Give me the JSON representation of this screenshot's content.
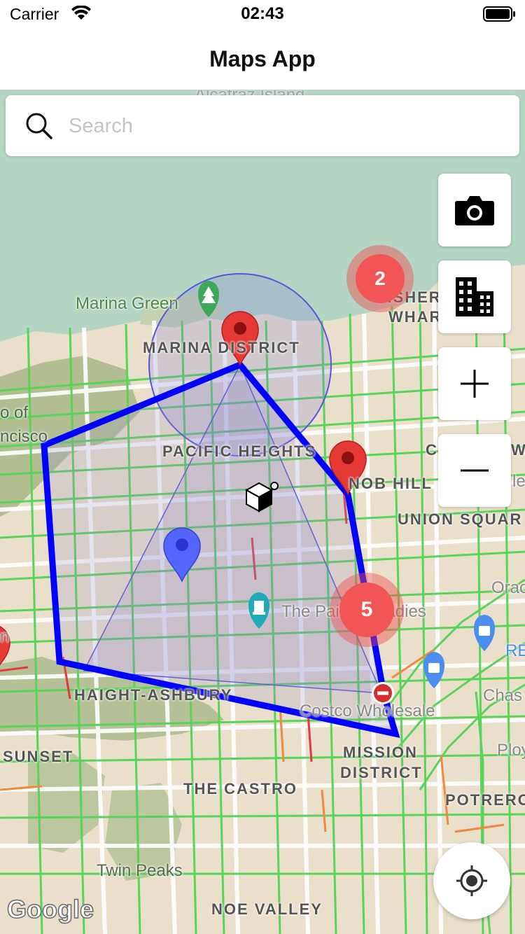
{
  "status_bar": {
    "carrier": "Carrier",
    "time": "02:43"
  },
  "nav": {
    "title": "Maps App"
  },
  "search": {
    "placeholder": "Search",
    "value": ""
  },
  "controls": {
    "camera": "camera-icon",
    "buildings": "buildings-icon",
    "zoom_in": "plus-icon",
    "zoom_out": "minus-icon",
    "my_location": "crosshair-icon"
  },
  "clusters": {
    "north": "2",
    "south": "5"
  },
  "map_labels": {
    "alcatraz": "Alcatraz Island",
    "marina_green": "Marina Green",
    "marina_district": "MARINA DISTRICT",
    "fisherman_wharf_1": "FISHERM",
    "fisherman_wharf_2": "WHAR",
    "pacific_heights": "PACIFIC HEIGHTS",
    "nob_hill": "NOB HILL",
    "union_square": "UNION SQUAR",
    "the_painted_ladies": "The Painted Ladies",
    "haight_ashbury": "HAIGHT-ASHBURY",
    "costco": "Costco Wholesale",
    "mission_district_1": "MISSION",
    "mission_district_2": "DISTRICT",
    "sunset": "SUNSET",
    "the_castro": "THE CASTRO",
    "twin_peaks": "Twin Peaks",
    "noe_valley": "NOE VALLEY",
    "potrero": "POTRERO",
    "oracle": "Orac",
    "chase": "Chas",
    "re": "RE",
    "ploy": "Ploy",
    "presidio_1": "o of",
    "presidio_2": "ncisco",
    "c_w": "C",
    "w": "W",
    "le": "le",
    "left_n": "n"
  },
  "attribution": "Google",
  "colors": {
    "route": "#0000ff",
    "circle": "#5555dd",
    "marker_red": "#e53935",
    "marker_blue": "#5566ff",
    "water": "#b4d4c4",
    "park": "#a8b888",
    "traffic_green": "#5ad35a",
    "traffic_orange": "#f08a3a",
    "traffic_red": "#e23a3a"
  }
}
